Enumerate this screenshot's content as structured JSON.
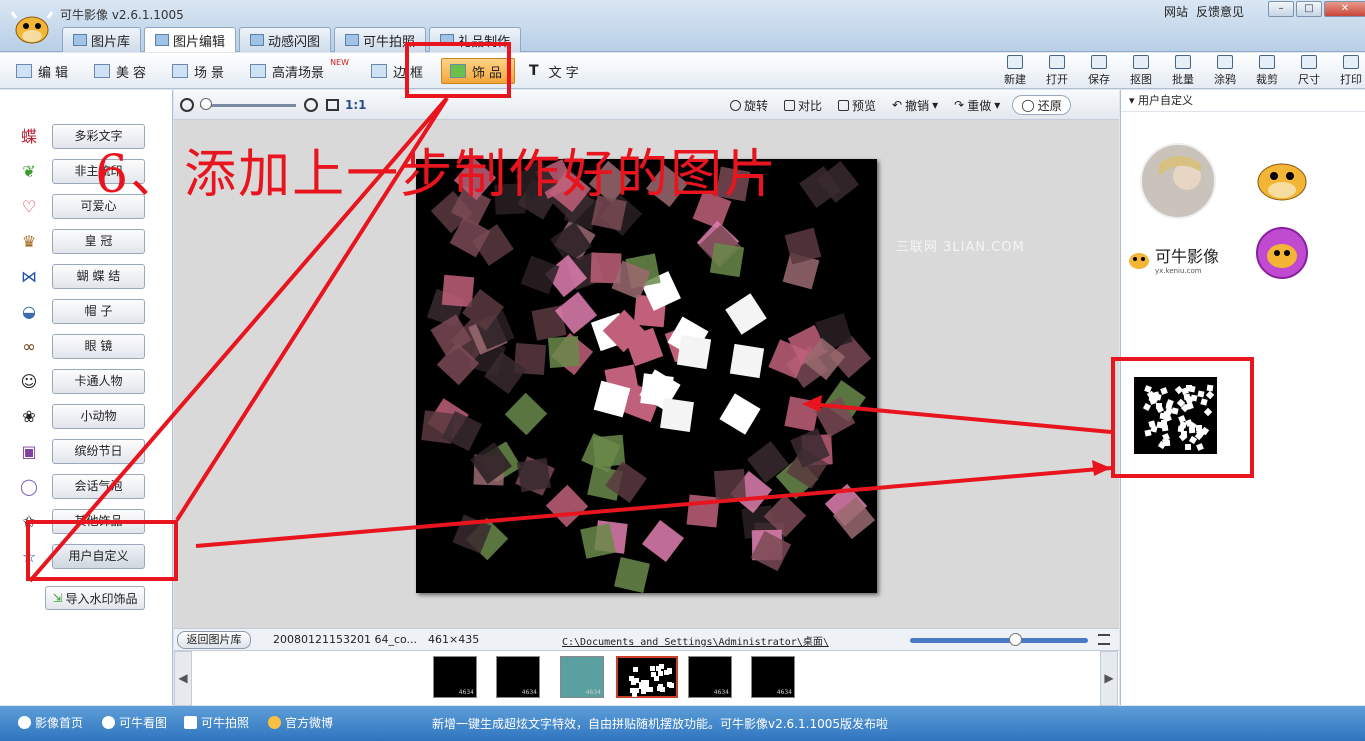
{
  "window": {
    "title": "可牛影像  v2.6.1.1005",
    "links": [
      "网站",
      "反馈意见"
    ],
    "buttons": [
      "–",
      "□",
      "✕"
    ]
  },
  "main_tabs": [
    {
      "label": "图片库",
      "active": false
    },
    {
      "label": "图片编辑",
      "active": true
    },
    {
      "label": "动感闪图",
      "active": false
    },
    {
      "label": "可牛拍照",
      "active": false
    },
    {
      "label": "礼品制作",
      "active": false
    }
  ],
  "sub_tabs": [
    {
      "label": "编辑",
      "active": false
    },
    {
      "label": "美容",
      "active": false
    },
    {
      "label": "场景",
      "active": false
    },
    {
      "label": "高清场景",
      "active": false,
      "badge": "NEW"
    },
    {
      "label": "边框",
      "active": false
    },
    {
      "label": "饰品",
      "active": true
    },
    {
      "label": "文字",
      "active": false
    }
  ],
  "tool_buttons": [
    "新建",
    "打开",
    "保存",
    "抠图",
    "批量",
    "涂鸦",
    "裁剪",
    "尺寸",
    "打印"
  ],
  "categories": [
    {
      "label": "多彩文字",
      "icon": "butterfly-text-icon"
    },
    {
      "label": "非主流印",
      "icon": "heart-leaf-icon"
    },
    {
      "label": "可爱心",
      "icon": "heart-outline-icon"
    },
    {
      "label": "皇  冠",
      "icon": "crown-icon"
    },
    {
      "label": "蝴 蝶 结",
      "icon": "bow-icon"
    },
    {
      "label": "帽  子",
      "icon": "hat-icon"
    },
    {
      "label": "眼  镜",
      "icon": "glasses-icon"
    },
    {
      "label": "卡通人物",
      "icon": "cartoon-face-icon"
    },
    {
      "label": "小动物",
      "icon": "animal-icon"
    },
    {
      "label": "缤纷节日",
      "icon": "gift-icon"
    },
    {
      "label": "会话气泡",
      "icon": "speech-bubble-icon"
    },
    {
      "label": "其他饰品",
      "icon": "star-badge-icon"
    },
    {
      "label": "用户自定义",
      "icon": "star-icon",
      "selected": true
    }
  ],
  "import_button": "导入水印饰品",
  "view_toolbar": {
    "ratio": "1:1",
    "actions": [
      "旋转",
      "对比",
      "预览",
      "撤销",
      "重做"
    ],
    "restore": "还原"
  },
  "canvas": {
    "watermark": "三联网 3LIAN.COM"
  },
  "status": {
    "back": "返回图片库",
    "file_name": "20080121153201 64_co...",
    "size": "461×435",
    "path": "C:\\Documents and Settings\\Administrator\\桌面\\"
  },
  "thumbnails": [
    {
      "label": "4634"
    },
    {
      "label": "4634"
    },
    {
      "label": "4634"
    },
    {
      "label": "",
      "selected": true
    },
    {
      "label": "4634"
    },
    {
      "label": "4634"
    }
  ],
  "right_panel": {
    "header": "用户自定义",
    "brand_text": "可牛影像",
    "brand_url": "yx.keniu.com"
  },
  "bottom_bar": {
    "items": [
      "影像首页",
      "可牛看图",
      "可牛拍照",
      "官方微博"
    ],
    "news": "新增一键生成超炫文字特效，自由拼贴随机摆放功能。可牛影像v2.6.1.1005版发布啦"
  },
  "annotation": {
    "text": "6、添加上一步制作好的图片"
  },
  "colors": {
    "annotation_red": "#e8141e",
    "accent_orange": "#f3a43a",
    "status_blue": "#2f74bf"
  }
}
